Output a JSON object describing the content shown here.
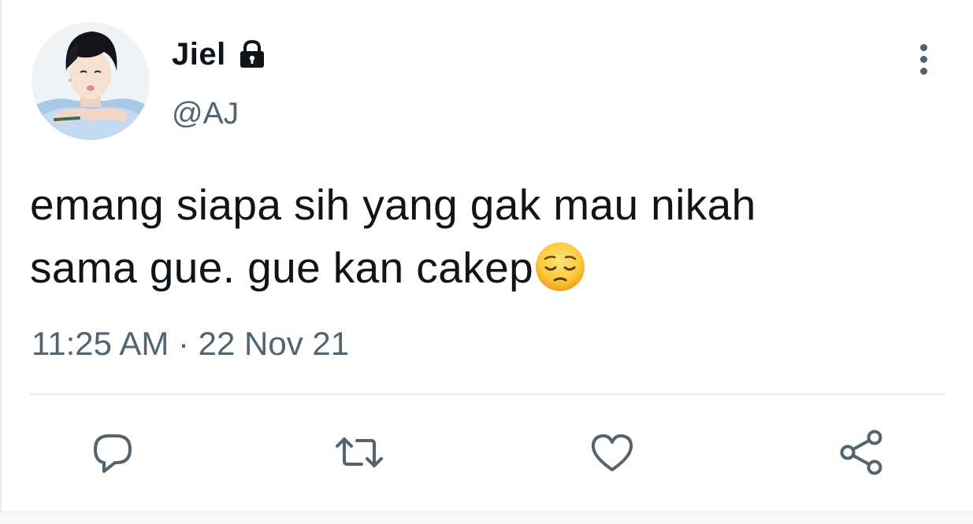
{
  "user": {
    "display_name": "Jiel",
    "handle": "@AJ",
    "protected_icon": "lock-icon",
    "avatar_icon": "avatar-photo"
  },
  "tweet": {
    "text_line1": "emang siapa sih yang gak mau nikah",
    "text_line2": "sama gue. gue kan cakep",
    "emoji": "pensive-face-emoji",
    "timestamp": "11:25 AM · 22 Nov 21"
  },
  "header": {
    "more_icon": "more-vertical-icon"
  },
  "actions": [
    {
      "name": "reply",
      "icon": "reply-icon"
    },
    {
      "name": "retweet",
      "icon": "retweet-icon"
    },
    {
      "name": "like",
      "icon": "heart-icon"
    },
    {
      "name": "share",
      "icon": "share-icon"
    }
  ],
  "colors": {
    "text_primary": "#0f1419",
    "text_secondary": "#536471",
    "divider": "#e6ecf0"
  }
}
